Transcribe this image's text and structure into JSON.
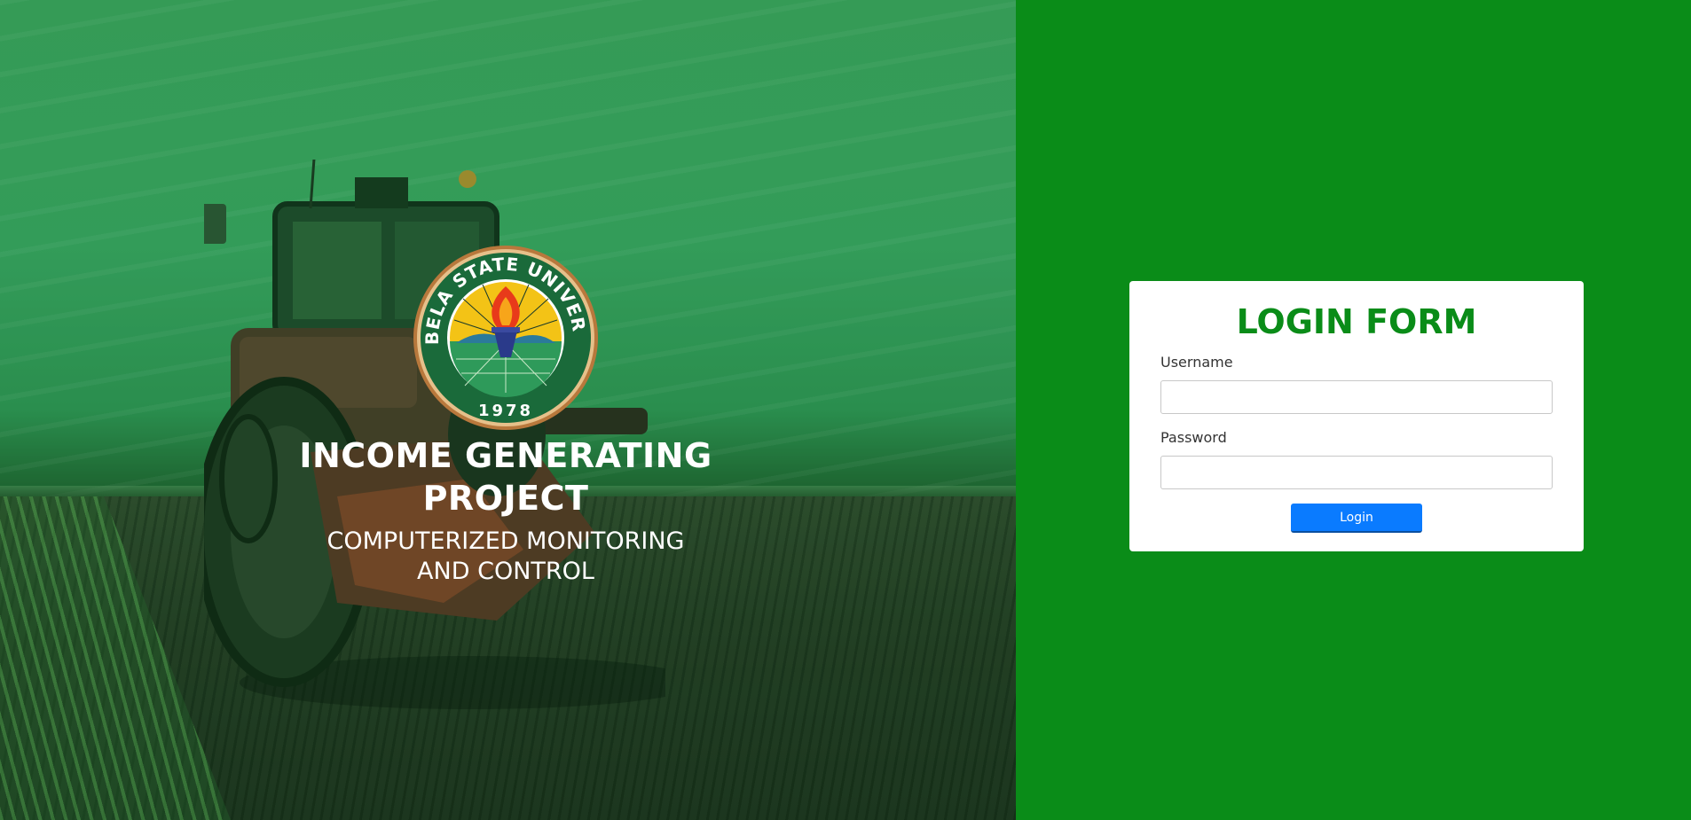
{
  "hero": {
    "logo": {
      "university": "ISABELA STATE UNIVERSITY",
      "year": "1978",
      "icon": "torch-seal-icon"
    },
    "title": "INCOME GENERATING PROJECT",
    "subtitle": "COMPUTERIZED MONITORING AND CONTROL"
  },
  "login": {
    "title": "LOGIN FORM",
    "username_label": "Username",
    "username_value": "",
    "password_label": "Password",
    "password_value": "",
    "button_label": "Login"
  },
  "colors": {
    "panel_green": "#0a8c18",
    "button_blue": "#0a7bff",
    "card_white": "#ffffff"
  }
}
